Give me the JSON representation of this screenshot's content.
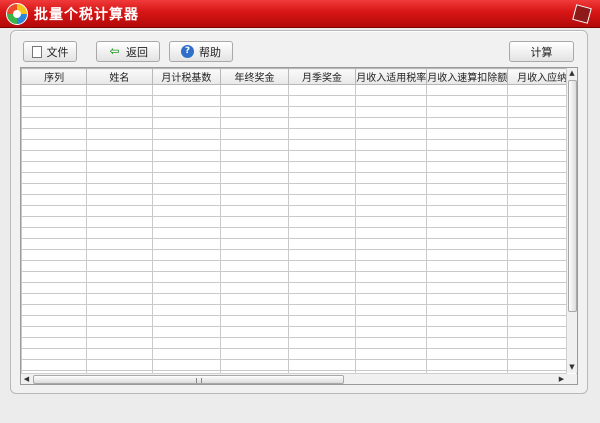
{
  "window": {
    "title": "批量个税计算器"
  },
  "toolbar": {
    "file_label": "文件",
    "back_label": "返回",
    "help_label": "帮助",
    "calc_label": "计算"
  },
  "table": {
    "columns": [
      "序列",
      "姓名",
      "月计税基数",
      "年终奖金",
      "月季奖金",
      "月收入适用税率",
      "月收入速算扣除额",
      "月收入应纳"
    ],
    "rows": []
  },
  "colors": {
    "titlebar": "#d71515",
    "panel": "#f1f1f1"
  },
  "icons": {
    "logo": "app-logo-icon",
    "file": "document-icon",
    "back": "green-left-arrow-icon",
    "help": "help-question-icon",
    "window_corner": "red-cube-icon"
  }
}
